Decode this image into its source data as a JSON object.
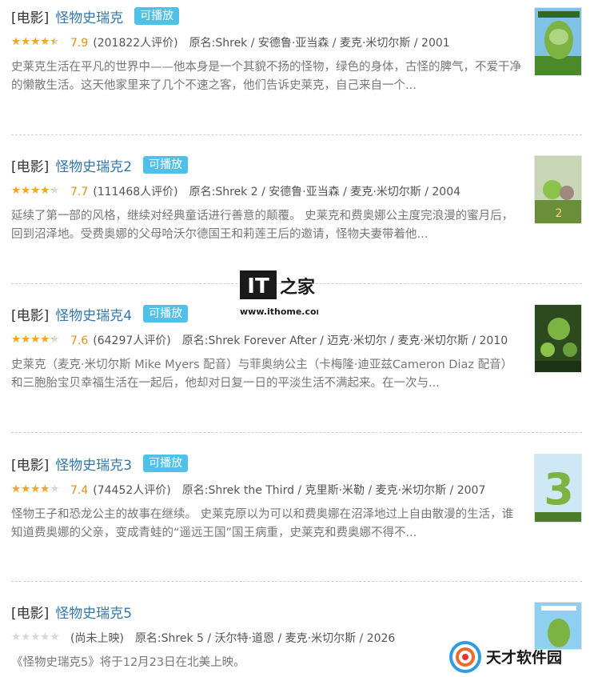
{
  "results": [
    {
      "category": "[电影]",
      "title": "怪物史瑞克",
      "badge": "可播放",
      "rating_fraction": 0.79,
      "score": "7.9",
      "count": "(201822人评价)",
      "original": "原名:Shrek / 安德鲁·亚当森 / 麦克·米切尔斯 / 2001",
      "description": "史莱克生活在平凡的世界中——他本身是一个其貌不扬的怪物，绿色的身体，古怪的脾气，不爱干净的懒散生活。这天他家里来了几个不速之客，他们告诉史莱克，自己来自一个..."
    },
    {
      "category": "[电影]",
      "title": "怪物史瑞克2",
      "badge": "可播放",
      "rating_fraction": 0.77,
      "score": "7.7",
      "count": "(111468人评价)",
      "original": "原名:Shrek 2 / 安德鲁·亚当森 / 麦克·米切尔斯 / 2004",
      "description": "延续了第一部的风格，继续对经典童话进行善意的颠覆。 史莱克和费奥娜公主度完浪漫的蜜月后，回到沼泽地。受费奥娜的父母哈沃尔德国王和莉莲王后的邀请，怪物夫妻带着他..."
    },
    {
      "category": "[电影]",
      "title": "怪物史瑞克4",
      "badge": "可播放",
      "rating_fraction": 0.76,
      "score": "7.6",
      "count": "(64297人评价)",
      "original": "原名:Shrek Forever After / 迈克·米切尔 / 麦克·米切尔斯 / 2010",
      "description": "史莱克（麦克·米切尔斯 Mike Myers 配音）与菲奥纳公主（卡梅隆·迪亚兹Cameron Diaz 配音）和三胞胎宝贝幸福生活在一起后，他却对日复一日的平淡生活不满起来。在一次与..."
    },
    {
      "category": "[电影]",
      "title": "怪物史瑞克3",
      "badge": "可播放",
      "rating_fraction": 0.74,
      "score": "7.4",
      "count": "(74452人评价)",
      "original": "原名:Shrek the Third / 克里斯·米勒 / 麦克·米切尔斯 / 2007",
      "description": "怪物王子和恐龙公主的故事在继续。 史莱克原以为可以和费奥娜在沼泽地过上自由散漫的生活，谁知道费奥娜的父亲，变成青蛙的“遥远王国”国王病重，史莱克和费奥娜不得不..."
    },
    {
      "category": "[电影]",
      "title": "怪物史瑞克5",
      "badge": "",
      "rating_fraction": 0,
      "score": "",
      "count": "(尚未上映)",
      "original": "原名:Shrek 5 / 沃尔特·道恩 / 麦克·米切尔斯 / 2026",
      "description": "《怪物史瑞克5》将于12月23日在北美上映。"
    }
  ],
  "watermark_it": {
    "letters": "IT",
    "chinese": "之家",
    "url": "www.ithome.com"
  },
  "watermark_tc": {
    "text": "天才软件园"
  },
  "colors": {
    "link": "#3377aa",
    "badge": "#4fc1e9",
    "star": "#f5a623",
    "score": "#e09015"
  }
}
